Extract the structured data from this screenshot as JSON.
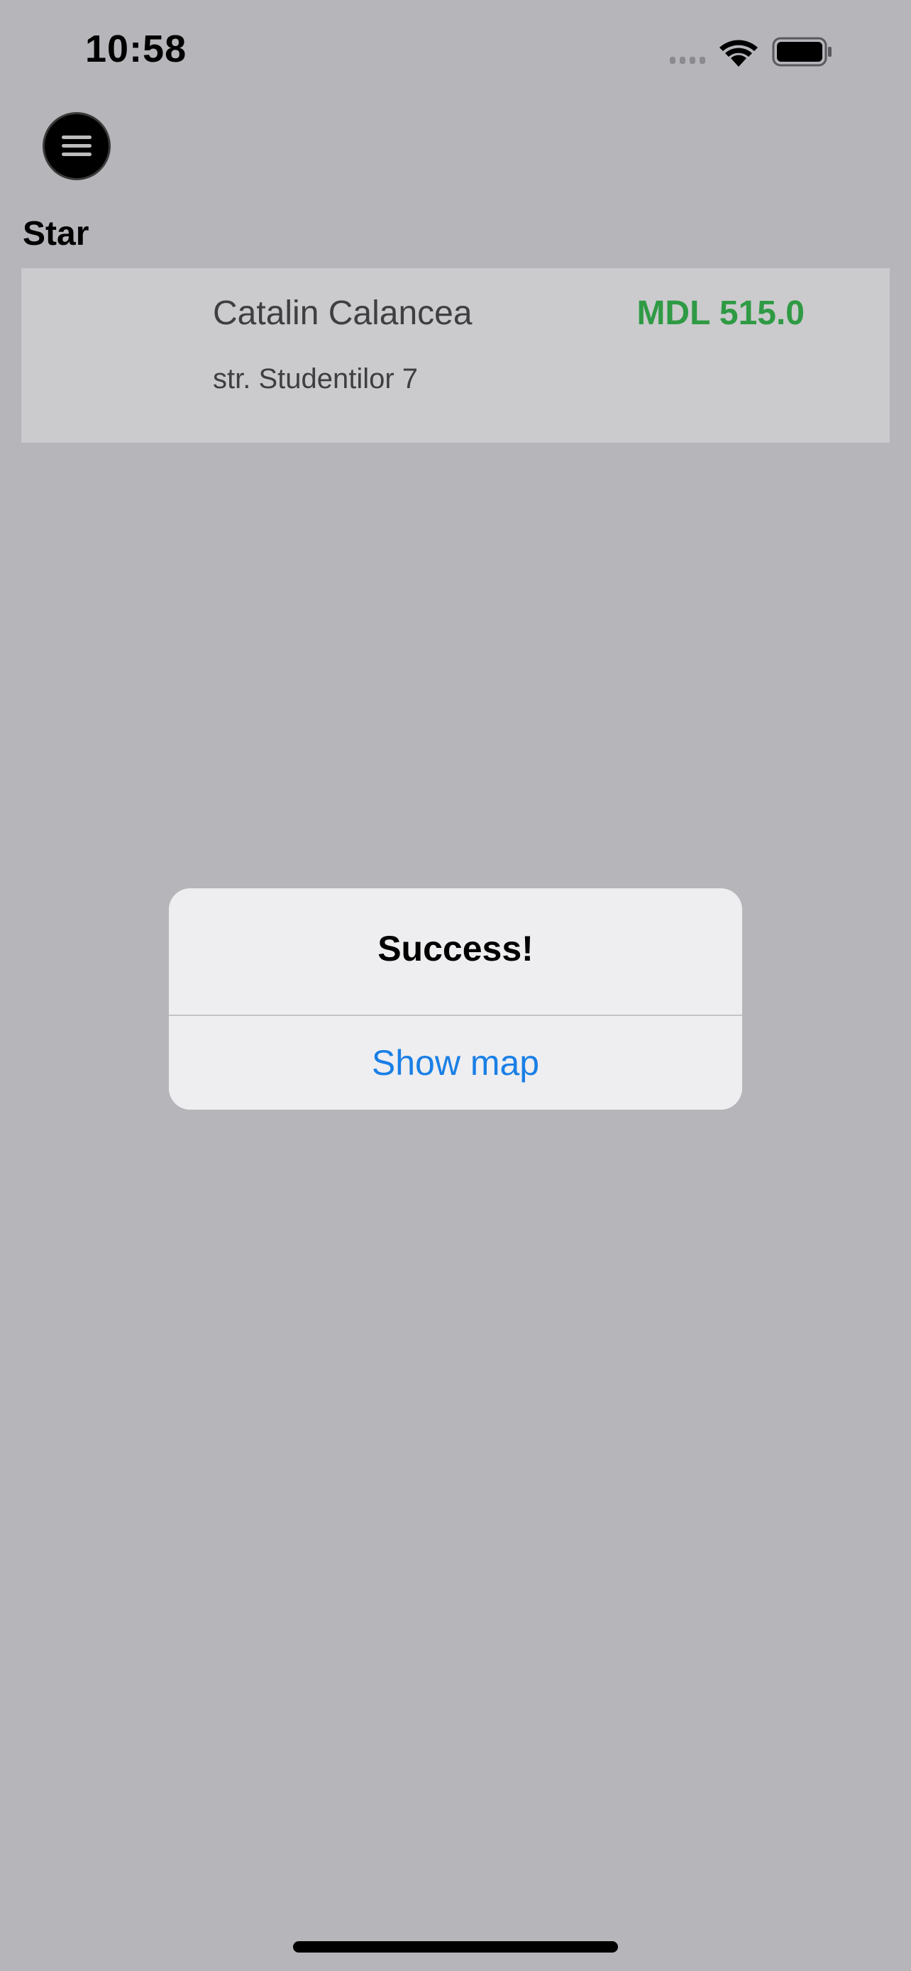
{
  "status_bar": {
    "time": "10:58",
    "icons": [
      "signal-icon",
      "wifi-icon",
      "battery-icon"
    ]
  },
  "header": {
    "menu_icon": "hamburger-menu-icon"
  },
  "section": {
    "title": "Star"
  },
  "list": {
    "items": [
      {
        "name": "Catalin Calancea",
        "price": "MDL 515.0",
        "address": "str. Studentilor 7"
      }
    ]
  },
  "alert": {
    "title": "Success!",
    "action_label": "Show map"
  },
  "colors": {
    "background_dim": "#b5b5ba",
    "card": "#cbcbcd",
    "price": "#2f9a44",
    "alert_bg": "#eeeef0",
    "link": "#1a7fe6"
  }
}
